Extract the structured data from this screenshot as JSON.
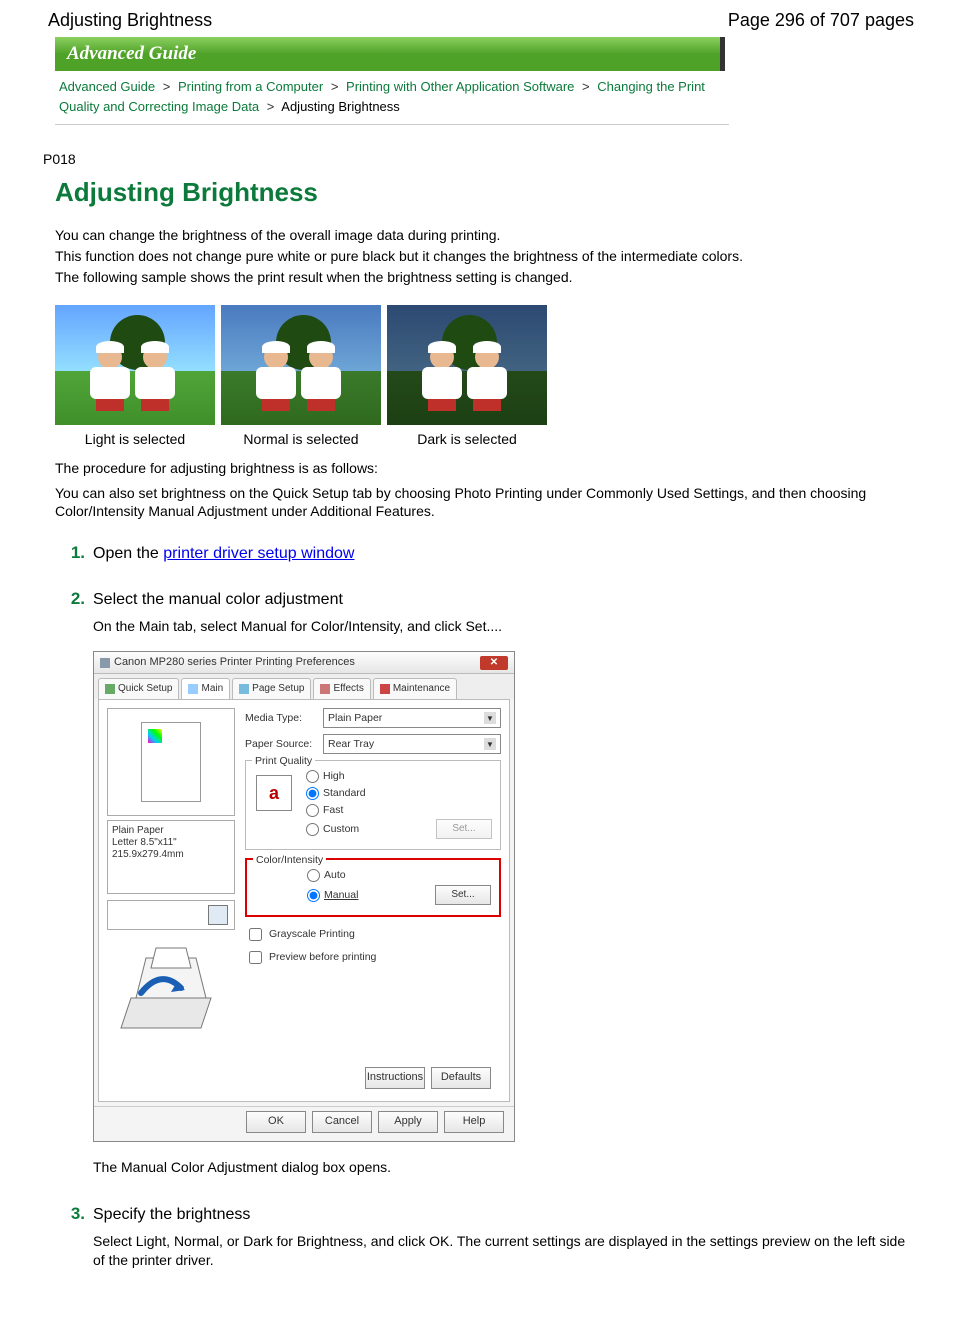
{
  "header": {
    "title": "Adjusting Brightness",
    "page_info": "Page 296 of 707 pages"
  },
  "banner": "Advanced Guide",
  "breadcrumb": {
    "items": [
      "Advanced Guide",
      "Printing from a Computer",
      "Printing with Other Application Software",
      "Changing the Print Quality and Correcting Image Data"
    ],
    "current": "Adjusting Brightness"
  },
  "page_code": "P018",
  "title": "Adjusting Brightness",
  "intro": {
    "p1": "You can change the brightness of the overall image data during printing.",
    "p2": "This function does not change pure white or pure black but it changes the brightness of the intermediate colors.",
    "p3": "The following sample shows the print result when the brightness setting is changed."
  },
  "samples": {
    "c1": "Light is selected",
    "c2": "Normal is selected",
    "c3": "Dark is selected"
  },
  "after": {
    "p1": "The procedure for adjusting brightness is as follows:",
    "p2": "You can also set brightness on the Quick Setup tab by choosing Photo Printing under Commonly Used Settings, and then choosing Color/Intensity Manual Adjustment under Additional Features."
  },
  "steps": {
    "s1": {
      "num": "1.",
      "title_pre": "Open the ",
      "link": "printer driver setup window"
    },
    "s2": {
      "num": "2.",
      "title": "Select the manual color adjustment",
      "body": "On the Main tab, select Manual for Color/Intensity, and click Set....",
      "after": "The Manual Color Adjustment dialog box opens."
    },
    "s3": {
      "num": "3.",
      "title": "Specify the brightness",
      "body": "Select Light, Normal, or Dark for Brightness, and click OK. The current settings are displayed in the settings preview on the left side of the printer driver."
    }
  },
  "dialog": {
    "title": "Canon MP280 series Printer Printing Preferences",
    "tabs": [
      "Quick Setup",
      "Main",
      "Page Setup",
      "Effects",
      "Maintenance"
    ],
    "media_type_label": "Media Type:",
    "media_type_value": "Plain Paper",
    "paper_source_label": "Paper Source:",
    "paper_source_value": "Rear Tray",
    "print_quality_label": "Print Quality",
    "pq_high": "High",
    "pq_standard": "Standard",
    "pq_fast": "Fast",
    "pq_custom": "Custom",
    "set_btn": "Set...",
    "color_intensity_label": "Color/Intensity",
    "ci_auto": "Auto",
    "ci_manual": "Manual",
    "grayscale": "Grayscale Printing",
    "preview": "Preview before printing",
    "info1": "Plain Paper",
    "info2": "Letter 8.5\"x11\" 215.9x279.4mm",
    "instructions": "Instructions",
    "defaults": "Defaults",
    "ok": "OK",
    "cancel": "Cancel",
    "apply": "Apply",
    "help": "Help",
    "a_icon": "a"
  }
}
